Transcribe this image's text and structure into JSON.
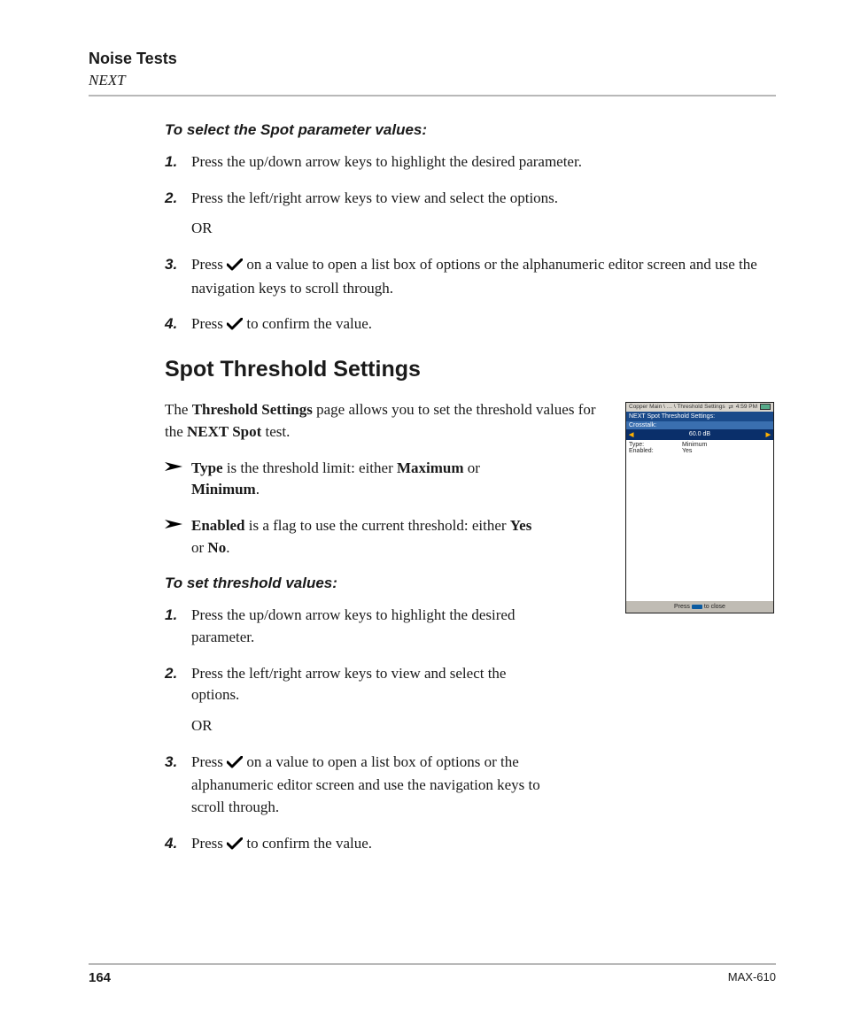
{
  "header": {
    "title": "Noise Tests",
    "subtitle": "NEXT"
  },
  "section1": {
    "subhead": "To select the Spot parameter values:",
    "steps": {
      "s1": {
        "num": "1.",
        "text": "Press the up/down arrow keys to highlight the desired parameter."
      },
      "s2": {
        "num": "2.",
        "text": "Press the left/right arrow keys to view and select the options.",
        "or": "OR"
      },
      "s3": {
        "num": "3.",
        "pre": "Press ",
        "post": " on a value to open a list box of options or the alphanumeric editor screen and use the navigation keys to scroll through."
      },
      "s4": {
        "num": "4.",
        "pre": "Press ",
        "post": " to confirm the value."
      }
    }
  },
  "section2": {
    "heading": "Spot Threshold Settings",
    "intro": {
      "a": "The ",
      "b": "Threshold Settings",
      "c": " page allows you to set the threshold values for the ",
      "d": "NEXT Spot",
      "e": " test."
    },
    "bullets": {
      "b1": {
        "a": "Type",
        "b": " is the threshold limit: either ",
        "c": "Maximum",
        "d": " or ",
        "e": "Minimum",
        "f": "."
      },
      "b2": {
        "a": "Enabled",
        "b": " is a flag to use the current threshold: either ",
        "c": "Yes",
        "d": " or ",
        "e": "No",
        "f": "."
      }
    },
    "subhead2": "To set threshold values:",
    "steps": {
      "s1": {
        "num": "1.",
        "text": "Press the up/down arrow keys to highlight the desired parameter."
      },
      "s2": {
        "num": "2.",
        "text": "Press the left/right arrow keys to view and select the options.",
        "or": "OR"
      },
      "s3": {
        "num": "3.",
        "pre": "Press ",
        "post": " on a value to open a list box of options or the alphanumeric editor screen and use the navigation keys to scroll through."
      },
      "s4": {
        "num": "4.",
        "pre": "Press ",
        "post": " to confirm the value."
      }
    }
  },
  "screenshot": {
    "breadcrumb": "Copper Main \\ … \\ Threshold Settings",
    "time": "4:59 PM",
    "title": "NEXT Spot Threshold Settings:",
    "subtitle": "Crosstalk:",
    "value": "60.0 dB",
    "left_arrow": "◀",
    "right_arrow": "▶",
    "rows": {
      "r1": {
        "k": "Type:",
        "v": "Minimum"
      },
      "r2": {
        "k": "Enabled:",
        "v": "Yes"
      }
    },
    "footer_pre": "Press ",
    "footer_post": " to close"
  },
  "footer": {
    "page": "164",
    "model": "MAX-610"
  }
}
